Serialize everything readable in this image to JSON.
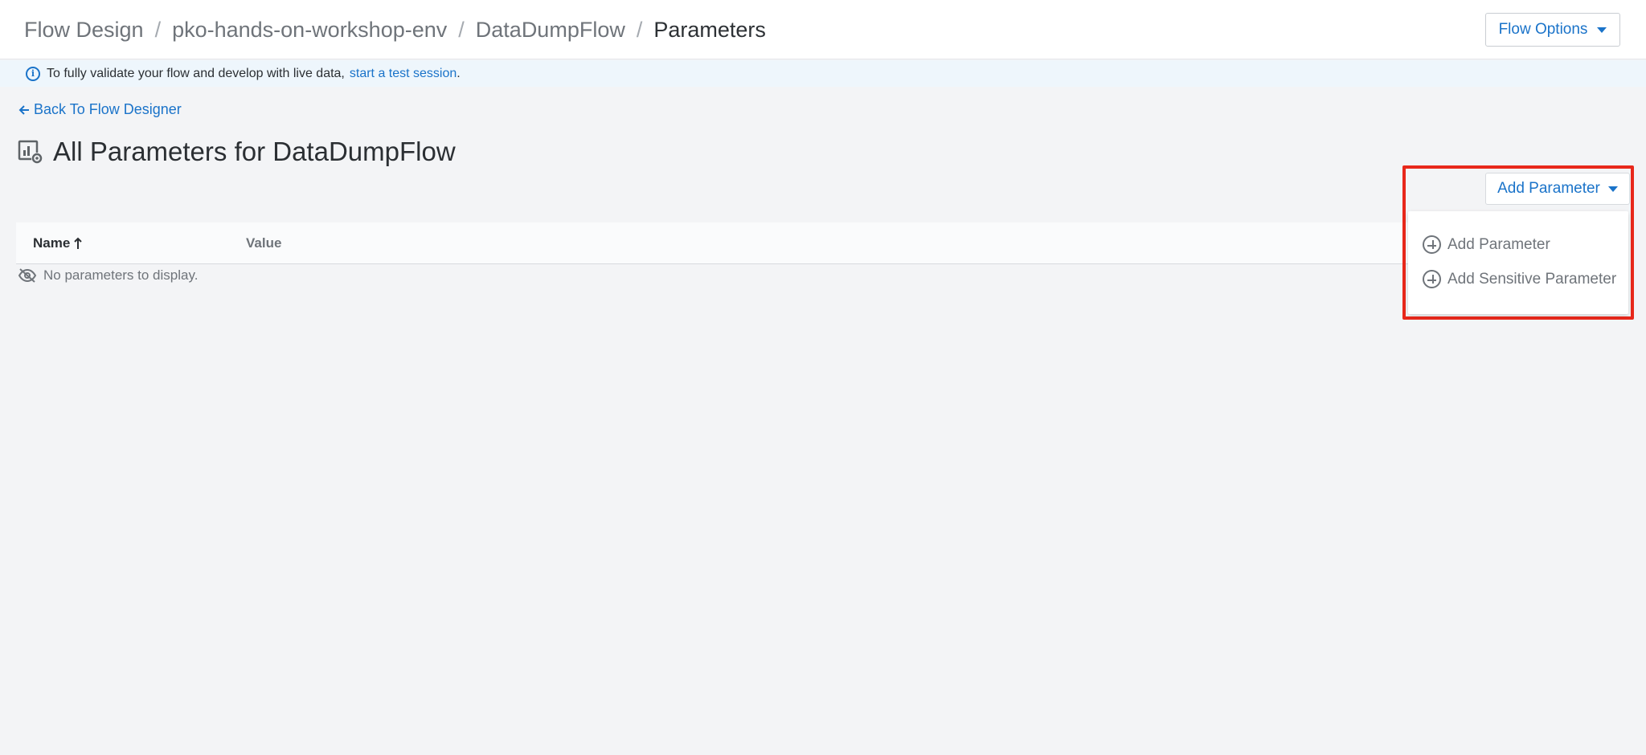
{
  "header": {
    "breadcrumb": [
      "Flow Design",
      "pko-hands-on-workshop-env",
      "DataDumpFlow",
      "Parameters"
    ],
    "separator": "/",
    "flow_options_label": "Flow Options"
  },
  "info": {
    "text": "To fully validate your flow and develop with live data,",
    "link": "start a test session",
    "suffix": "."
  },
  "back_link": "Back To Flow Designer",
  "page_title": "All Parameters for DataDumpFlow",
  "table": {
    "columns": [
      "Name",
      "Value"
    ],
    "sort_icon": "arrow-up-icon",
    "empty_text": "No parameters to display."
  },
  "add_parameter": {
    "button_label": "Add Parameter",
    "menu": [
      "Add Parameter",
      "Add Sensitive Parameter"
    ]
  },
  "colors": {
    "accent": "#1a73c9",
    "highlight": "#e8281b"
  }
}
